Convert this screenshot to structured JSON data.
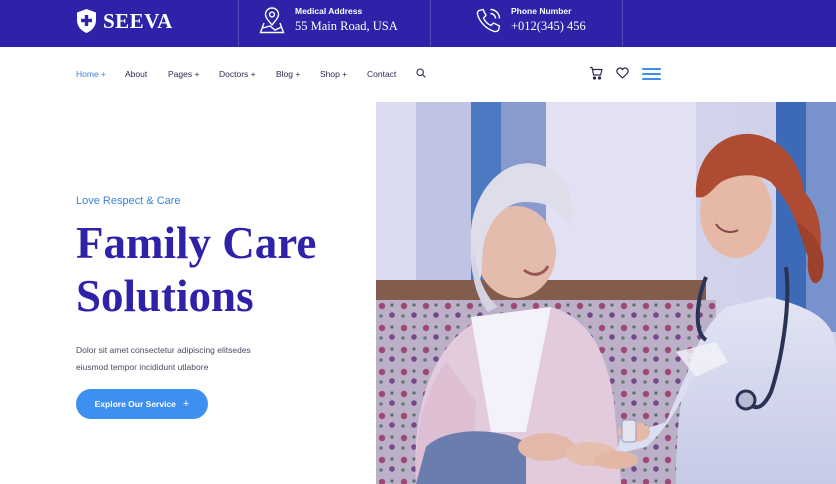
{
  "brand": {
    "name": "SEEVA",
    "logo_icon": "shield-cross-icon"
  },
  "topbar": {
    "address": {
      "icon": "map-pin-icon",
      "label": "Medical Address",
      "value": "55 Main Road, USA"
    },
    "phone": {
      "icon": "phone-icon",
      "label": "Phone Number",
      "value": "+012(345) 456"
    }
  },
  "nav": {
    "items": [
      {
        "label": "Home +",
        "active": true
      },
      {
        "label": "About"
      },
      {
        "label": "Pages +"
      },
      {
        "label": "Doctors +"
      },
      {
        "label": "Blog +"
      },
      {
        "label": "Shop +"
      },
      {
        "label": "Contact"
      }
    ],
    "icons": [
      "search-icon",
      "cart-icon",
      "heart-icon",
      "hamburger-menu-icon"
    ]
  },
  "hero": {
    "tagline": "Love Respect & Care",
    "title_line1": "Family Care",
    "title_line2": "Solutions",
    "desc_line1": "Dolor sit amet consectetur adipiscing elitsedes",
    "desc_line2": "eiusmod tempor incididunt utlabore",
    "cta_label": "Explore Our Service",
    "cta_icon": "+",
    "image": "photo of nurse assisting elderly woman"
  },
  "colors": {
    "brand_blue": "#2e22a8",
    "accent_blue": "#3b82d6",
    "button_blue": "#3d8ff0",
    "nav_text": "#2a2a50"
  }
}
